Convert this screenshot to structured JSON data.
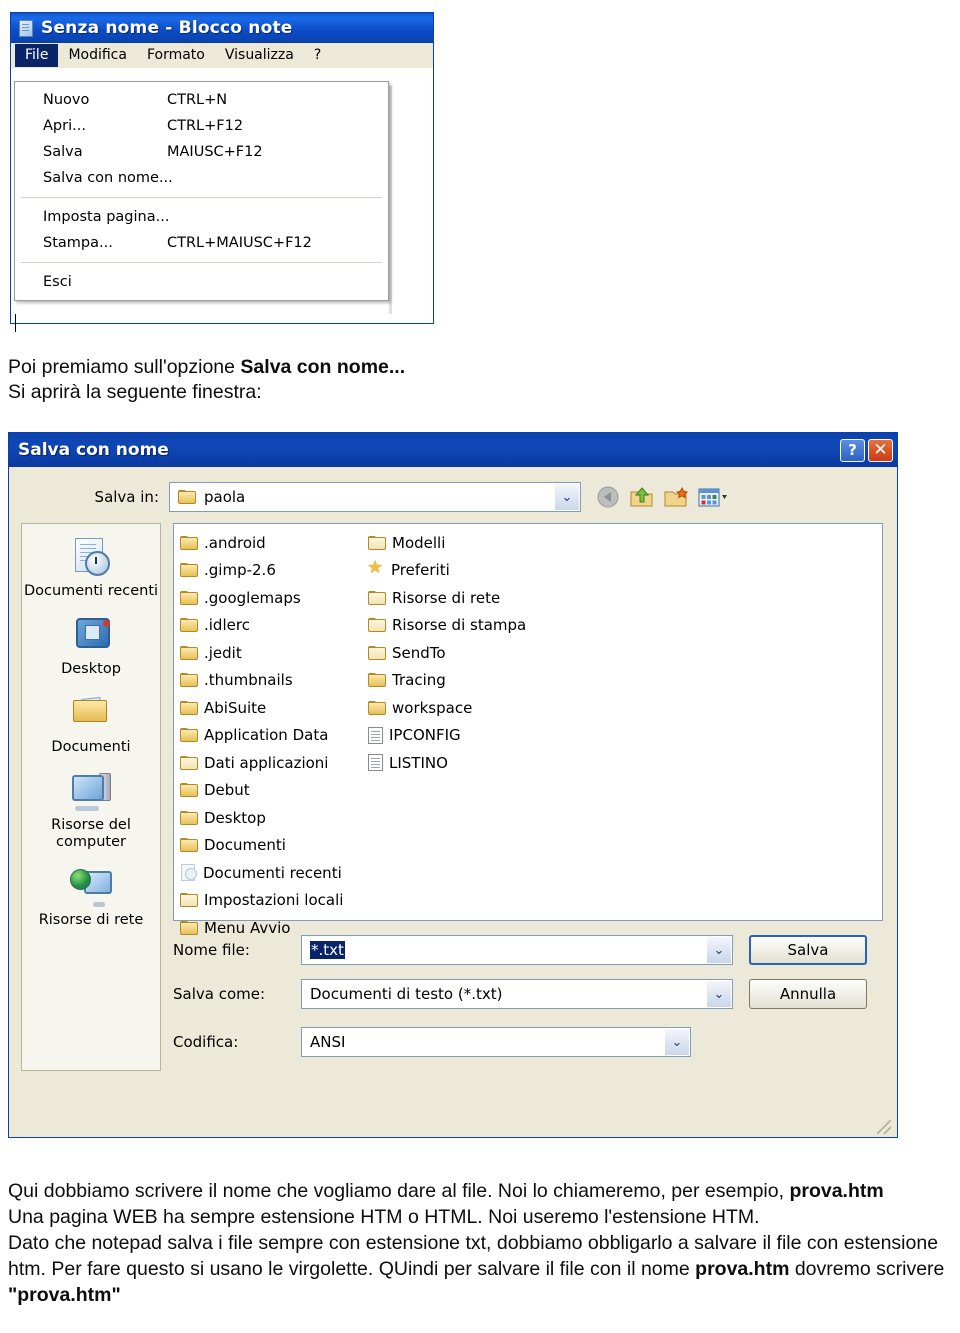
{
  "notepad": {
    "title": "Senza nome - Blocco note",
    "icon": "notepad-icon",
    "menubar": [
      {
        "label": "File",
        "active": true
      },
      {
        "label": "Modifica",
        "active": false
      },
      {
        "label": "Formato",
        "active": false
      },
      {
        "label": "Visualizza",
        "active": false
      },
      {
        "label": "?",
        "active": false
      }
    ],
    "file_menu": [
      {
        "label": "Nuovo",
        "accel": "CTRL+N"
      },
      {
        "label": "Apri...",
        "accel": "CTRL+F12"
      },
      {
        "label": "Salva",
        "accel": "MAIUSC+F12"
      },
      {
        "label": "Salva con nome...",
        "accel": ""
      },
      {
        "separator": true
      },
      {
        "label": "Imposta pagina...",
        "accel": ""
      },
      {
        "label": "Stampa...",
        "accel": "CTRL+MAIUSC+F12"
      },
      {
        "separator": true
      },
      {
        "label": "Esci",
        "accel": ""
      }
    ]
  },
  "prose_top": {
    "line1_a": "Poi premiamo sull'opzione ",
    "line1_b": "Salva con nome...",
    "line2": "Si aprirà la seguente finestra:"
  },
  "dialog": {
    "title": "Salva con nome",
    "help_button": "?",
    "close_button": "✕",
    "save_in_label": "Salva in:",
    "save_in_value": "paola",
    "toolbar": [
      {
        "name": "back-icon",
        "label": "Indietro"
      },
      {
        "name": "up-folder-icon",
        "label": "Cartella superiore"
      },
      {
        "name": "new-folder-icon",
        "label": "Nuova cartella"
      },
      {
        "name": "views-icon",
        "label": "Visualizza"
      }
    ],
    "places": [
      {
        "label": "Documenti recenti",
        "icon": "recent-documents-icon"
      },
      {
        "label": "Desktop",
        "icon": "desktop-icon"
      },
      {
        "label": "Documenti",
        "icon": "documents-icon"
      },
      {
        "label": "Risorse del computer",
        "icon": "my-computer-icon"
      },
      {
        "label": "Risorse di rete",
        "icon": "network-places-icon"
      }
    ],
    "files_col1": [
      {
        "name": ".android",
        "icon": "folder-icon"
      },
      {
        "name": ".gimp-2.6",
        "icon": "folder-icon"
      },
      {
        "name": ".googlemaps",
        "icon": "folder-icon"
      },
      {
        "name": ".idlerc",
        "icon": "folder-icon"
      },
      {
        "name": ".jedit",
        "icon": "folder-icon"
      },
      {
        "name": ".thumbnails",
        "icon": "folder-icon"
      },
      {
        "name": "AbiSuite",
        "icon": "folder-icon"
      },
      {
        "name": "Application Data",
        "icon": "folder-icon"
      },
      {
        "name": "Dati applicazioni",
        "icon": "folder-pale-icon"
      },
      {
        "name": "Debut",
        "icon": "folder-icon"
      },
      {
        "name": "Desktop",
        "icon": "folder-icon"
      },
      {
        "name": "Documenti",
        "icon": "folder-icon"
      },
      {
        "name": "Documenti recenti",
        "icon": "recent-documents-small-icon"
      },
      {
        "name": "Impostazioni locali",
        "icon": "folder-pale-icon"
      },
      {
        "name": "Menu Avvio",
        "icon": "folder-icon"
      }
    ],
    "files_col2": [
      {
        "name": "Modelli",
        "icon": "folder-pale-icon"
      },
      {
        "name": "Preferiti",
        "icon": "favorites-star-icon"
      },
      {
        "name": "Risorse di rete",
        "icon": "folder-pale-icon"
      },
      {
        "name": "Risorse di stampa",
        "icon": "folder-pale-icon"
      },
      {
        "name": "SendTo",
        "icon": "folder-pale-icon"
      },
      {
        "name": "Tracing",
        "icon": "folder-icon"
      },
      {
        "name": "workspace",
        "icon": "folder-icon"
      },
      {
        "name": "IPCONFIG",
        "icon": "text-file-icon"
      },
      {
        "name": "LISTINO",
        "icon": "text-file-icon"
      }
    ],
    "filename_label": "Nome file:",
    "filename_value": "*.txt",
    "filetype_label": "Salva come:",
    "filetype_value": "Documenti di testo (*.txt)",
    "encoding_label": "Codifica:",
    "encoding_value": "ANSI",
    "save_button": "Salva",
    "cancel_button": "Annulla"
  },
  "prose_bottom": {
    "p1_a": "Qui dobbiamo scrivere il nome che vogliamo dare al file. Noi lo chiameremo, per esempio, ",
    "p1_b": "prova.htm",
    "p2": "Una pagina WEB ha sempre estensione HTM o HTML. Noi useremo l'estensione HTM.",
    "p3_a": "Dato che notepad salva i file sempre con estensione txt, dobbiamo obbligarlo a salvare il file con estensione htm. Per fare questo si usano le virgolette. QUindi per salvare il file con il nome ",
    "p3_b": "prova.htm",
    "p3_c": " dovremo scrivere ",
    "p3_d": "\"prova.htm\""
  }
}
